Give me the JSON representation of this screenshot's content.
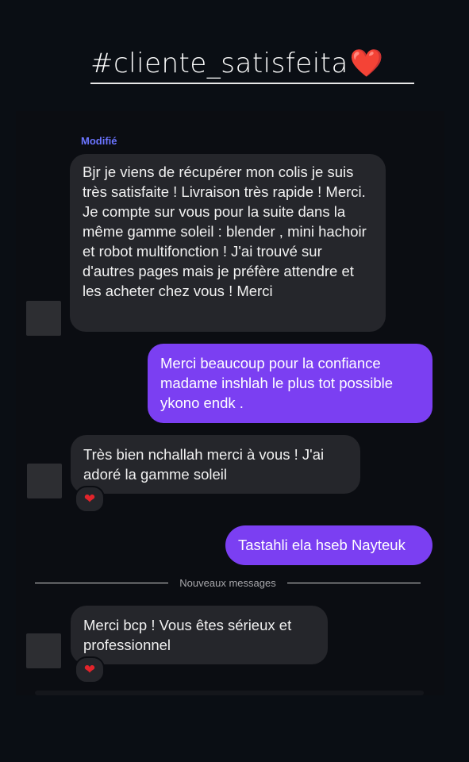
{
  "header": {
    "hashtag": "#cliente_satisfeita",
    "heart_emoji": "❤️"
  },
  "thread": {
    "edited_label": "Modifié",
    "messages": [
      {
        "direction": "incoming",
        "text": "Bjr je viens de récupérer mon colis je suis très satisfaite ! Livraison très rapide ! Merci. Je compte sur vous pour la suite dans la même gamme soleil : blender , mini hachoir et robot multifonction ! J'ai trouvé sur d'autres pages mais je préfère attendre et les acheter chez vous  ! Merci"
      },
      {
        "direction": "outgoing",
        "text": "Merci beaucoup pour la confiance madame inshlah le plus tot possible ykono endk ."
      },
      {
        "direction": "incoming",
        "text": "Très bien nchallah merci à vous ! J'ai adoré la gamme soleil",
        "reaction": "❤"
      },
      {
        "direction": "outgoing",
        "text": "Tastahli ela hseb Nayteuk"
      },
      {
        "direction": "incoming",
        "text": "Merci bcp ! Vous êtes sérieux et professionnel",
        "reaction": "❤"
      }
    ],
    "new_messages_label": "Nouveaux messages"
  },
  "colors": {
    "background": "#0a0e14",
    "incoming_bubble": "#25262b",
    "outgoing_bubble": "#7b3ff2",
    "edited_label": "#6b74ff",
    "heart": "#e3242b"
  }
}
